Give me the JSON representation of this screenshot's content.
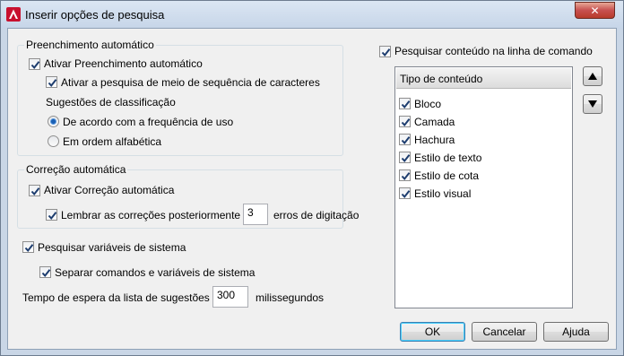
{
  "window": {
    "title": "Inserir opções de pesquisa",
    "close_symbol": "✕",
    "app_icon": "autocad-icon"
  },
  "autocomplete": {
    "group_label": "Preenchimento automático",
    "enable_label": "Ativar Preenchimento automático",
    "enable_checked": true,
    "midstring_label": "Ativar a pesquisa de meio de sequência de caracteres",
    "midstring_checked": true,
    "sort_label": "Sugestões de classificação",
    "sort_options": [
      "De acordo com a frequência de uso",
      "Em ordem alfabética"
    ],
    "sort_selected": "De acordo com a frequência de uso"
  },
  "autocorrect": {
    "group_label": "Correção automática",
    "enable_label": "Ativar Correção automática",
    "enable_checked": true,
    "remember_label": "Lembrar as correções posteriormente",
    "remember_checked": true,
    "remember_value": "3",
    "remember_suffix": "erros de digitação"
  },
  "sysvars": {
    "search_label": "Pesquisar variáveis de sistema",
    "search_checked": true,
    "separate_label": "Separar comandos e variáveis de sistema",
    "separate_checked": true
  },
  "delay": {
    "label": "Tempo de espera da lista de sugestões",
    "value": "300",
    "unit": "milissegundos"
  },
  "content": {
    "search_label": "Pesquisar conteúdo na linha de comando",
    "search_checked": true,
    "list_header": "Tipo de conteúdo",
    "items": [
      {
        "label": "Bloco",
        "checked": true
      },
      {
        "label": "Camada",
        "checked": true
      },
      {
        "label": "Hachura",
        "checked": true
      },
      {
        "label": "Estilo de texto",
        "checked": true
      },
      {
        "label": "Estilo de cota",
        "checked": true
      },
      {
        "label": "Estilo visual",
        "checked": true
      }
    ],
    "move_up_icon": "arrow-up-icon",
    "move_down_icon": "arrow-down-icon"
  },
  "buttons": {
    "ok": "OK",
    "cancel": "Cancelar",
    "help": "Ajuda"
  },
  "colors": {
    "title_bar": "#c6d5e8",
    "close_button": "#c75050",
    "checkmark": "#1c3c6e"
  }
}
